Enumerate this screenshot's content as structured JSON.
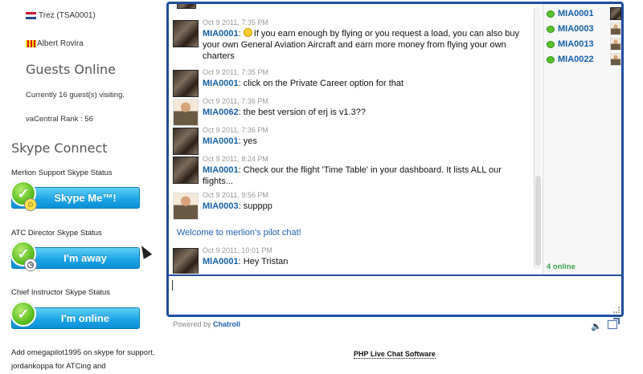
{
  "sidebar": {
    "pilots": [
      {
        "name": "Trez (TSA0001)",
        "flag": "nl-flag-icon"
      },
      {
        "name": "Albert Rovira",
        "flag": "catalonia-flag-icon"
      }
    ],
    "guests_heading": "Guests Online",
    "guests_text": "Currently 16 guest(s) visiting.",
    "rank_text": "vaCentral Rank : 56",
    "skype_heading": "Skype Connect",
    "statuses": [
      {
        "label": "Merlion Support Skype Status",
        "button": "Skype Me™!"
      },
      {
        "label": "ATC Director Skype Status",
        "button": "I'm away"
      },
      {
        "label": "Chief Instructor Skype Status",
        "button": "I'm online"
      }
    ],
    "bottom_note": "Add omegapilot1995 on skype for support, jordankoppa for ATCing and"
  },
  "chat": {
    "messages": [
      {
        "time": "Oct 9 2011, 7:35 PM",
        "nick": "MIA0001",
        "text": "If you earn enough by flying or you request a load, you can also buy your own General Aviation Aircraft and earn more money from flying your own charters",
        "avatar": "pilot"
      },
      {
        "time": "Oct 9 2011, 7:35 PM",
        "nick": "MIA0001",
        "text": "click on the Private Career option for that",
        "avatar": "pilot"
      },
      {
        "time": "Oct 9 2011, 7:36 PM",
        "nick": "MIA0062",
        "text": "the best version of erj is v1.3??",
        "avatar": "doll"
      },
      {
        "time": "Oct 9 2011, 7:36 PM",
        "nick": "MIA0001",
        "text": "yes",
        "avatar": "pilot"
      },
      {
        "time": "Oct 9 2011, 8:24 PM",
        "nick": "MIA0001",
        "text": "Check our the flight 'Time Table' in your dashboard. It lists ALL our flights...",
        "avatar": "pilot"
      },
      {
        "time": "Oct 9 2011, 9:56 PM",
        "nick": "MIA0003",
        "text": "supppp",
        "avatar": "doll"
      },
      {
        "time": "Oct 9 2011, 10:01 PM",
        "nick": "MIA0001",
        "text": "Hey Tristan",
        "avatar": "pilot"
      }
    ],
    "welcome": "Welcome to merlion's pilot chat!",
    "users": [
      "MIA0001",
      "MIA0003",
      "MIA0013",
      "MIA0022"
    ],
    "online_count": "4 online",
    "powered_prefix": "Powered by",
    "powered_brand": "Chatroll"
  },
  "footer": {
    "php_link": "PHP Live Chat Software"
  }
}
